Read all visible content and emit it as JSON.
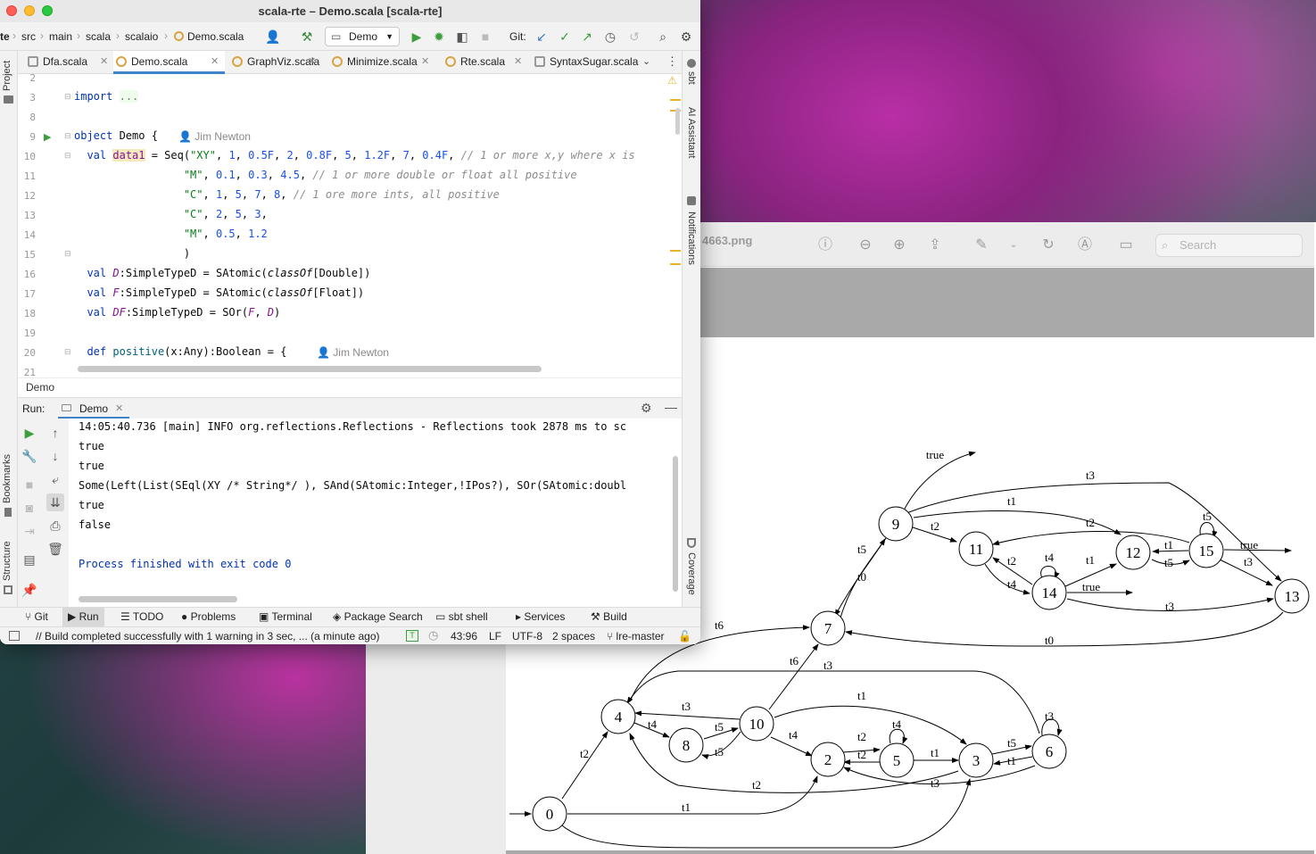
{
  "ide": {
    "window_title": "scala-rte – Demo.scala [scala-rte]",
    "breadcrumbs": [
      "te",
      "src",
      "main",
      "scala",
      "scalaio",
      "Demo.scala"
    ],
    "run_config": "Demo",
    "git_label": "Git:",
    "tabs": [
      {
        "label": "Dfa.scala"
      },
      {
        "label": "Demo.scala",
        "active": true
      },
      {
        "label": "GraphViz.scala"
      },
      {
        "label": "Minimize.scala"
      },
      {
        "label": "Rte.scala"
      },
      {
        "label": "SyntaxSugar.scala"
      }
    ],
    "left_strip": {
      "project": "Project",
      "bookmarks": "Bookmarks",
      "structure": "Structure"
    },
    "right_strip": {
      "sbt": "sbt",
      "ai": "AI Assistant",
      "notifications": "Notifications",
      "coverage": "Coverage"
    },
    "author": "Jim Newton",
    "line_numbers": [
      "2",
      "3",
      "8",
      "9",
      "10",
      "11",
      "12",
      "13",
      "14",
      "15",
      "16",
      "17",
      "18",
      "19",
      "20",
      "21"
    ],
    "code_breadcrumb": "Demo",
    "run_panel": {
      "label": "Run:",
      "tab": "Demo"
    },
    "console_lines": [
      "14:05:40.736 [main] INFO org.reflections.Reflections - Reflections took 2878 ms to sc",
      "true",
      "true",
      "Some(Left(List(SEql(XY /* String*/ ), SAnd(SAtomic:Integer,!IPos?), SOr(SAtomic:doubl",
      "true",
      "false",
      "",
      "Process finished with exit code 0"
    ],
    "tool_windows": [
      "Git",
      "Run",
      "TODO",
      "Problems",
      "Terminal",
      "Package Search",
      "sbt shell",
      "Services",
      "Build"
    ],
    "status": {
      "message": "// Build completed successfully with 1 warning in 3 sec, ... (a minute ago)",
      "position": "43:96",
      "line_sep": "LF",
      "encoding": "UTF-8",
      "indent": "2 spaces",
      "branch": "lre-master"
    }
  },
  "preview": {
    "title": "4663.png",
    "search_placeholder": "Search"
  },
  "graph": {
    "nodes": [
      "0",
      "2",
      "3",
      "4",
      "5",
      "6",
      "7",
      "8",
      "9",
      "10",
      "11",
      "12",
      "13",
      "14",
      "15"
    ],
    "edge_labels": [
      "true",
      "t3",
      "t1",
      "t2",
      "t2",
      "t1",
      "t5",
      "true",
      "t5",
      "t0",
      "t4",
      "t2",
      "t1",
      "t5",
      "t3",
      "t4",
      "true",
      "t3",
      "t6",
      "t0",
      "t6",
      "t3",
      "t1",
      "t3",
      "t4",
      "t5",
      "t5",
      "t4",
      "t2",
      "t4",
      "t2",
      "t1",
      "t5",
      "t1",
      "t3",
      "t2",
      "t3",
      "t2",
      "t1"
    ]
  }
}
